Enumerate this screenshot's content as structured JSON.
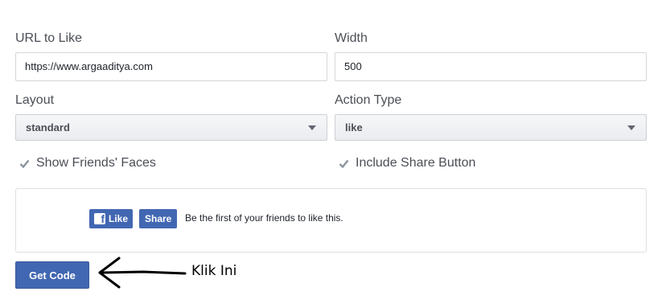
{
  "form": {
    "url_label": "URL to Like",
    "url_value": "https://www.argaaditya.com",
    "width_label": "Width",
    "width_value": "500",
    "layout_label": "Layout",
    "layout_value": "standard",
    "action_label": "Action Type",
    "action_value": "like",
    "faces_label": "Show Friends' Faces",
    "faces_checked": true,
    "share_label": "Include Share Button",
    "share_checked": true
  },
  "preview": {
    "like_label": "Like",
    "share_label": "Share",
    "social_text": "Be the first of your friends to like this."
  },
  "actions": {
    "get_code_label": "Get Code"
  },
  "annotation": {
    "text": "Klik Ini"
  },
  "colors": {
    "facebook_blue": "#4267b2",
    "text": "#4b4f56"
  }
}
